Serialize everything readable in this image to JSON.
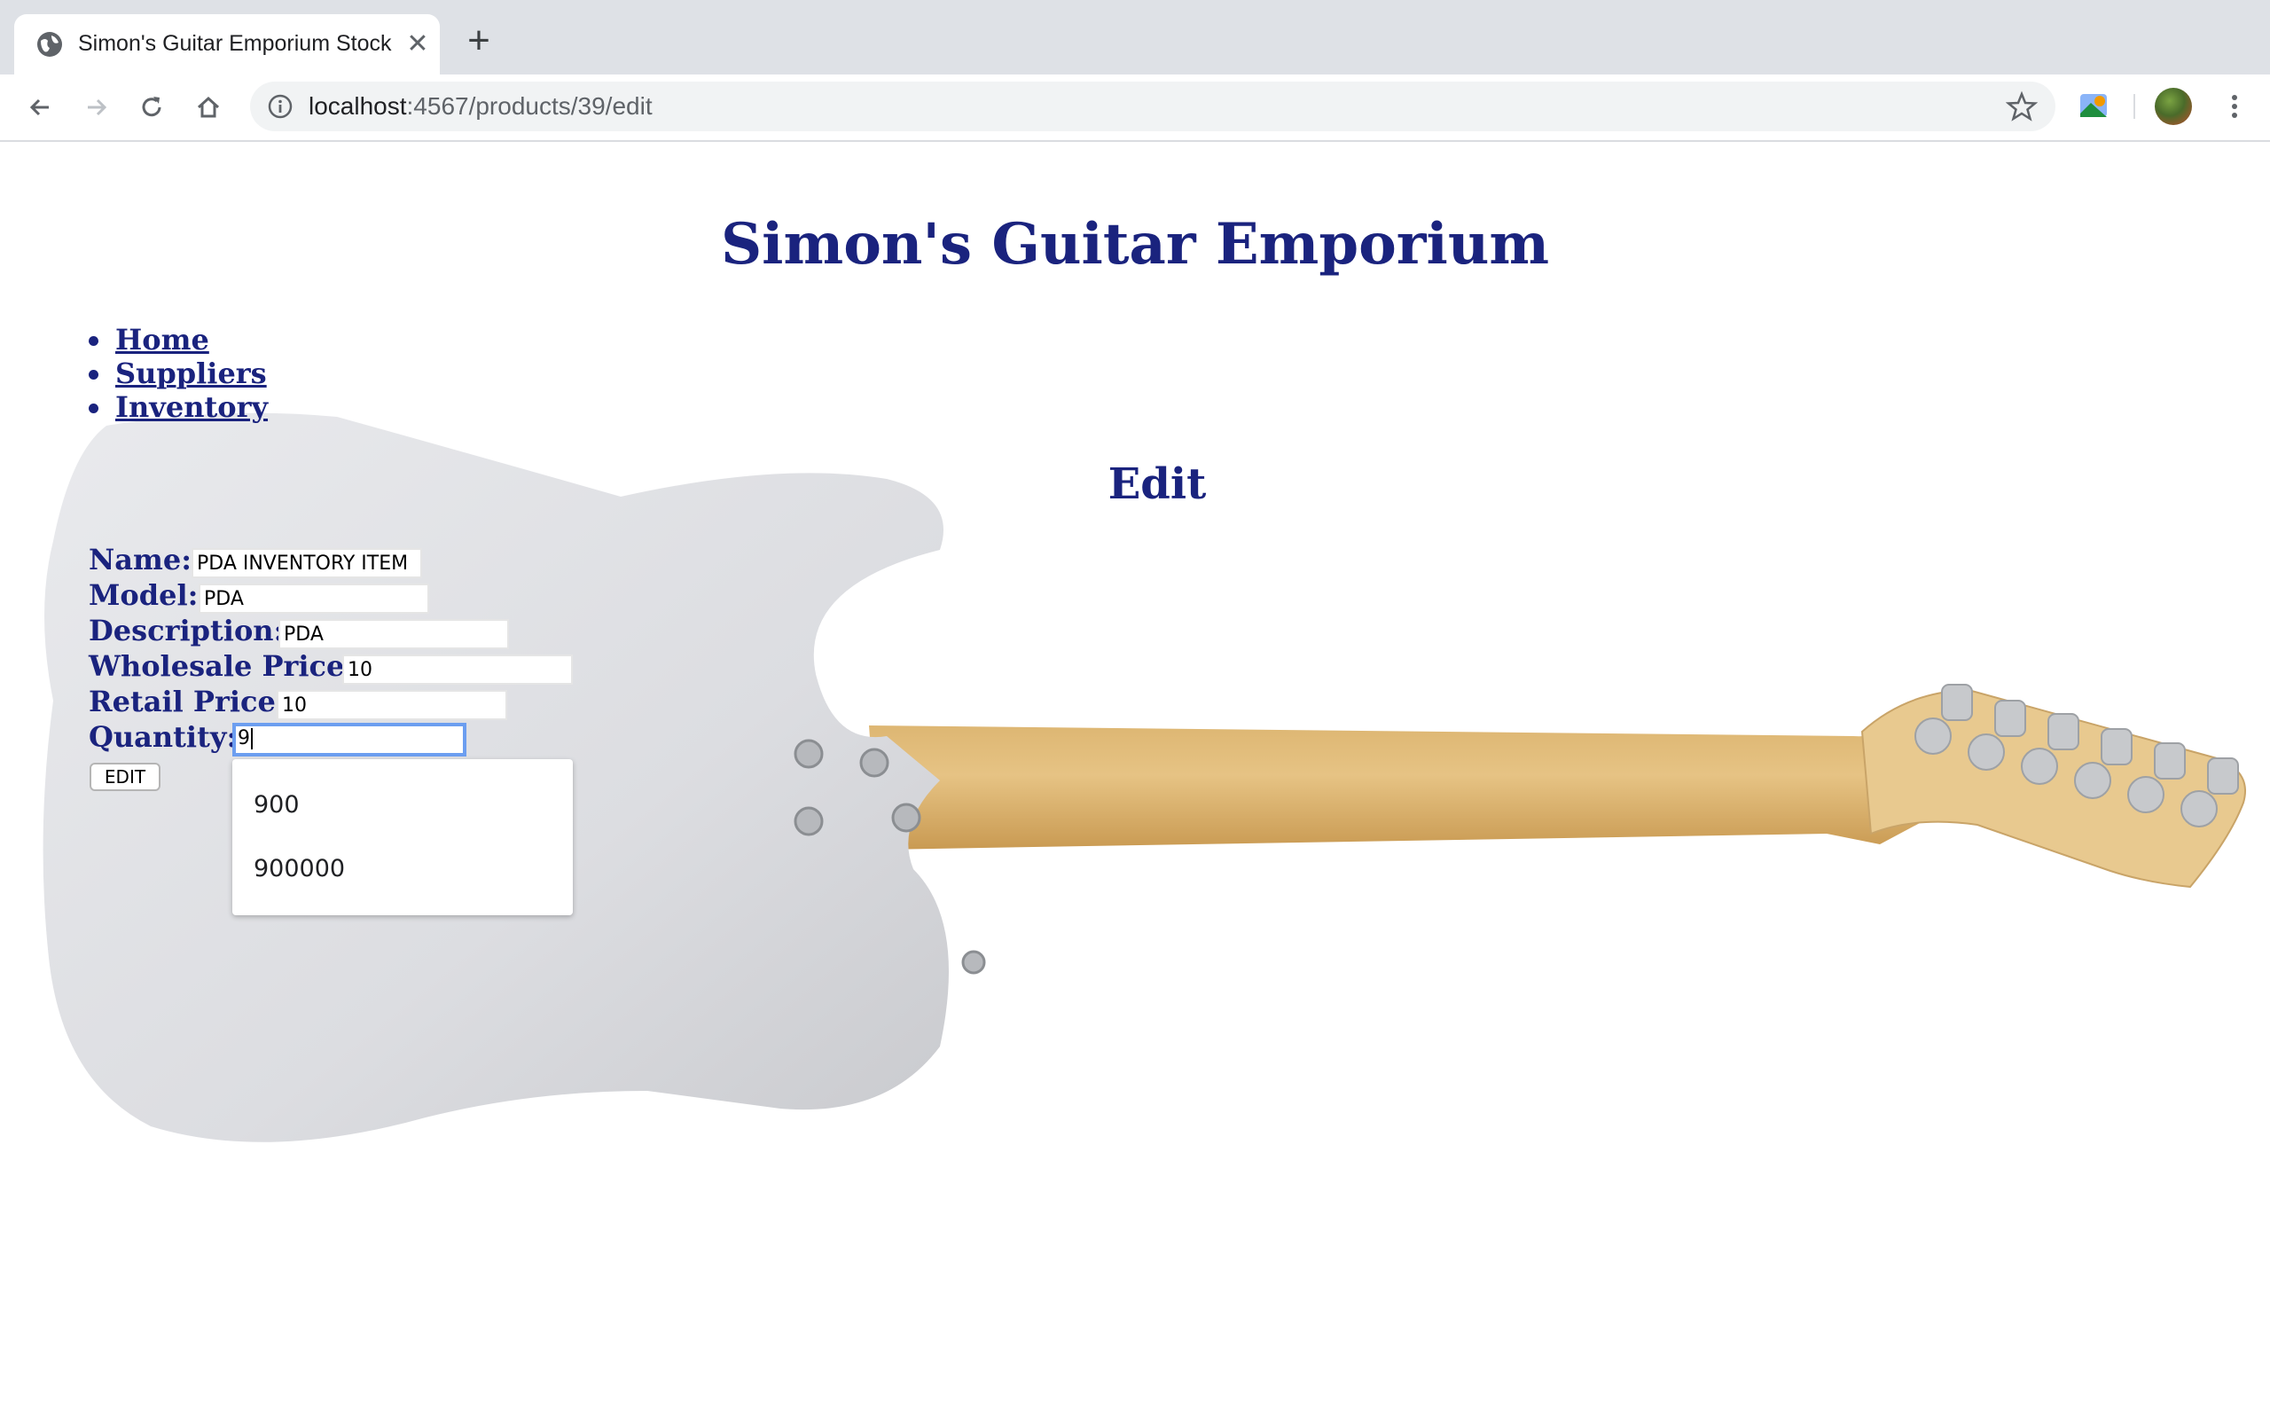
{
  "browser": {
    "tab_title": "Simon's Guitar Emporium Stock",
    "tab_close": "✕",
    "new_tab": "+",
    "url_host": "localhost",
    "url_path": ":4567/products/39/edit"
  },
  "page": {
    "site_title": "Simon's Guitar Emporium",
    "nav": [
      "Home",
      "Suppliers",
      "Inventory"
    ],
    "heading": "Edit",
    "form": {
      "name_label": "Name:",
      "name_value": "PDA INVENTORY ITEM",
      "model_label": "Model:",
      "model_value": "PDA",
      "description_label": "Description:",
      "description_value": "PDA",
      "wholesale_label": "Wholesale Price:",
      "wholesale_value": "10",
      "retail_label": "Retail Price:",
      "retail_value": "10",
      "quantity_label": "Quantity:",
      "quantity_value": "9",
      "submit_label": "EDIT"
    },
    "autocomplete": [
      "900",
      "900000"
    ]
  },
  "colors": {
    "brand": "#1a237e",
    "focus": "#6c9ef0"
  },
  "icons": [
    "globe-icon",
    "back-icon",
    "forward-icon",
    "reload-icon",
    "home-icon",
    "info-icon",
    "star-icon",
    "extension-icon",
    "profile-avatar",
    "menu-icon"
  ]
}
